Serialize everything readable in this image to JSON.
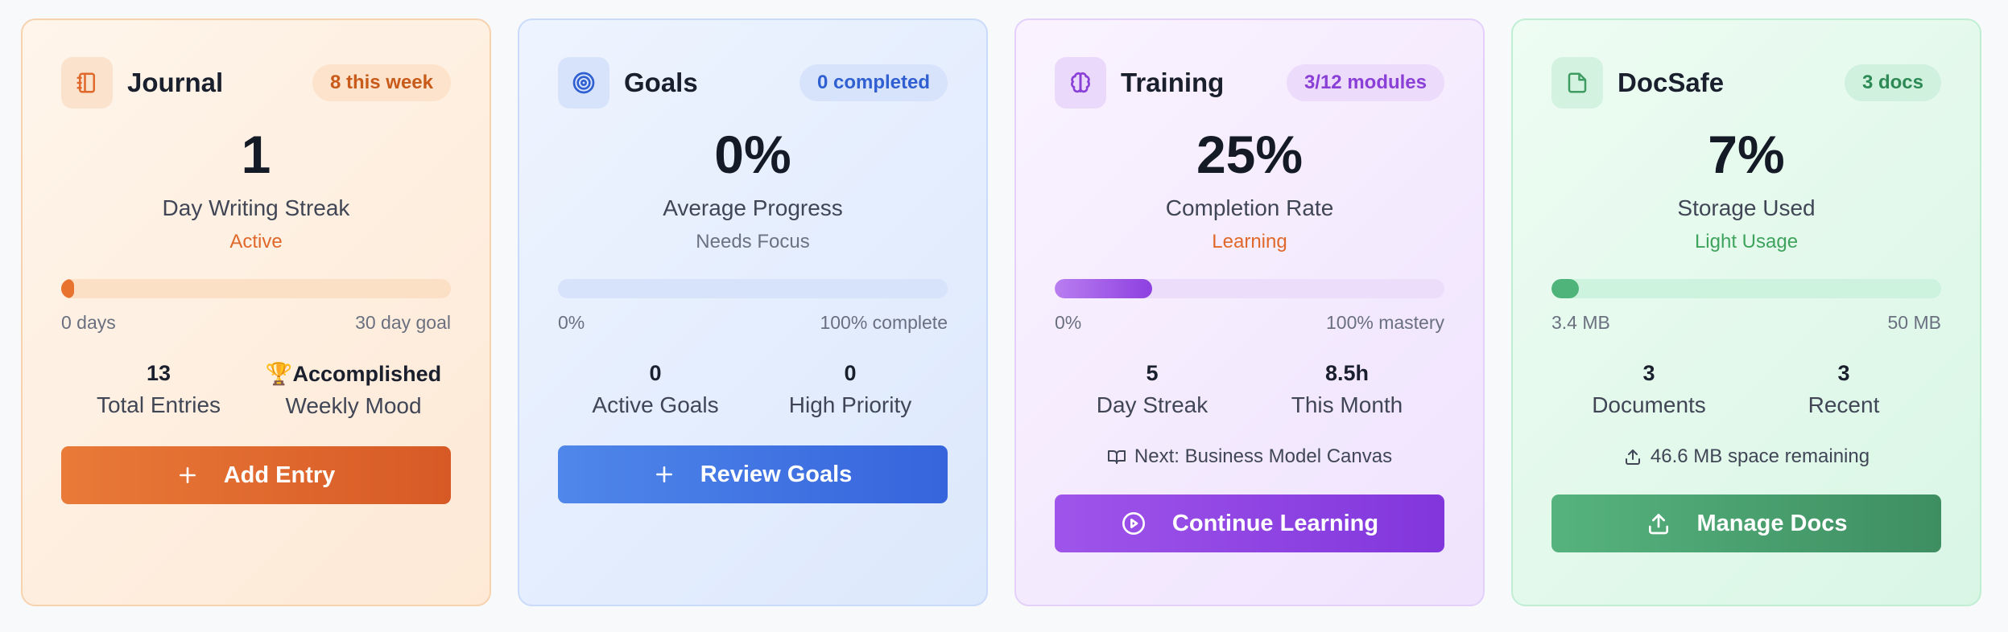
{
  "cards": [
    {
      "title": "Journal",
      "badge": "8 this week",
      "big": "1",
      "subtitle": "Day Writing Streak",
      "state": "Active",
      "progress": 0.03,
      "range_left": "0 days",
      "range_right": "30 day goal",
      "stats": [
        {
          "value": "13",
          "label": "Total Entries"
        },
        {
          "value": "Accomplished",
          "label": "Weekly Mood",
          "icon": "trophy-icon"
        }
      ],
      "button": "Add Entry",
      "icon": "notebook-icon",
      "button_icon": "plus-icon"
    },
    {
      "title": "Goals",
      "badge": "0 completed",
      "big": "0%",
      "subtitle": "Average Progress",
      "state": "Needs Focus",
      "progress": 0,
      "range_left": "0%",
      "range_right": "100% complete",
      "stats": [
        {
          "value": "0",
          "label": "Active Goals"
        },
        {
          "value": "0",
          "label": "High Priority"
        }
      ],
      "button": "Review Goals",
      "icon": "target-icon",
      "button_icon": "plus-icon"
    },
    {
      "title": "Training",
      "badge": "3/12 modules",
      "big": "25%",
      "subtitle": "Completion Rate",
      "state": "Learning",
      "progress": 0.25,
      "range_left": "0%",
      "range_right": "100% mastery",
      "stats": [
        {
          "value": "5",
          "label": "Day Streak"
        },
        {
          "value": "8.5h",
          "label": "This Month"
        }
      ],
      "note": "Next: Business Model Canvas",
      "button": "Continue Learning",
      "icon": "brain-icon",
      "button_icon": "play-circle-icon"
    },
    {
      "title": "DocSafe",
      "badge": "3 docs",
      "big": "7%",
      "subtitle": "Storage Used",
      "state": "Light Usage",
      "progress": 0.07,
      "range_left": "3.4 MB",
      "range_right": "50 MB",
      "stats": [
        {
          "value": "3",
          "label": "Documents"
        },
        {
          "value": "3",
          "label": "Recent"
        }
      ],
      "note": "46.6 MB space remaining",
      "button": "Manage Docs",
      "icon": "file-icon",
      "button_icon": "upload-icon"
    }
  ]
}
